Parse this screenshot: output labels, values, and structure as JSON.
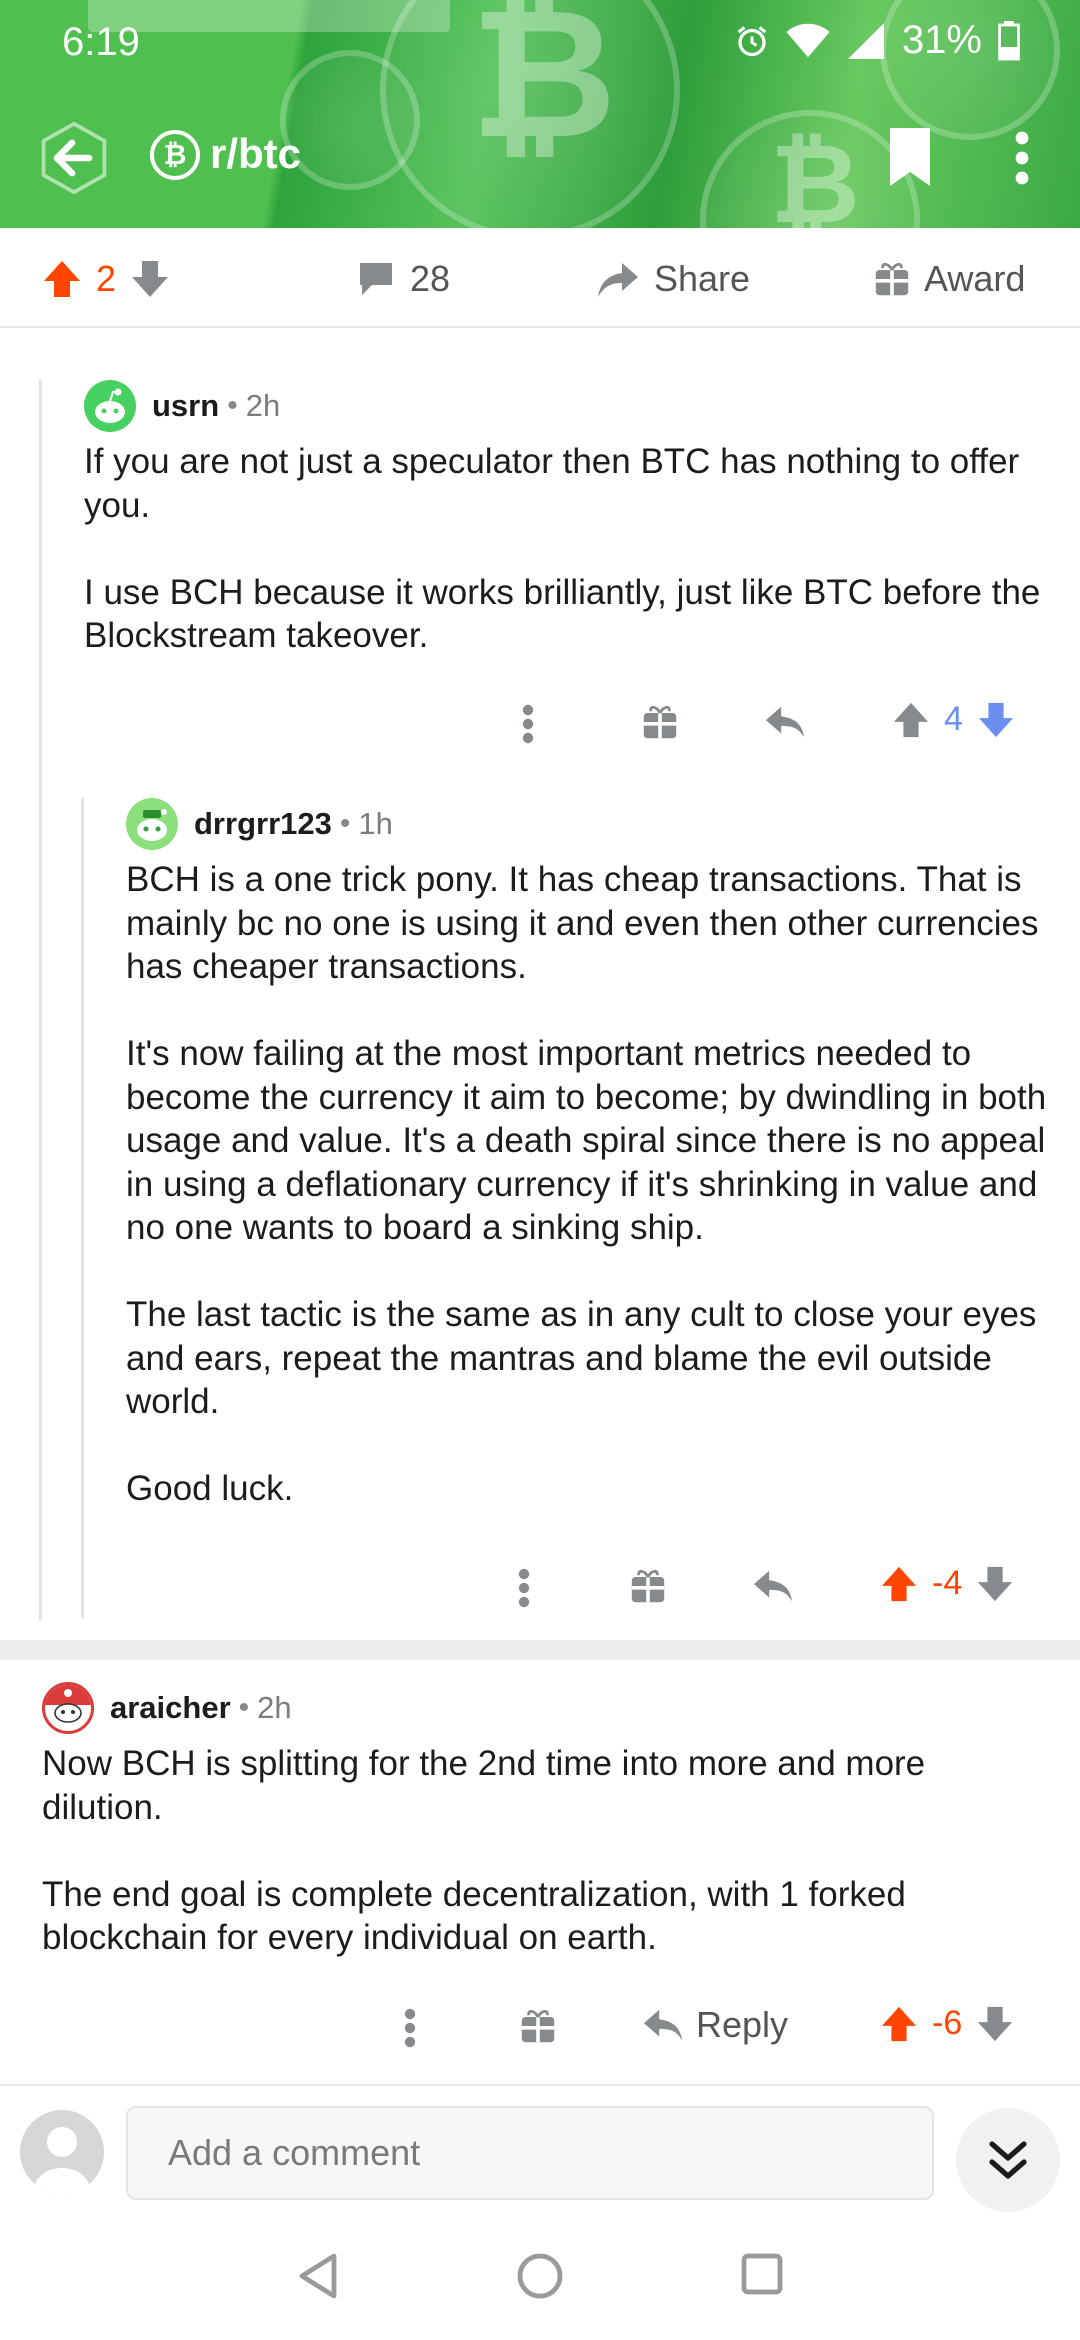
{
  "status": {
    "time": "6:19",
    "battery": "31%"
  },
  "subreddit": {
    "name": "r/btc",
    "icon_glyph": "₿"
  },
  "post_actions": {
    "score": "2",
    "comments": "28",
    "share": "Share",
    "award": "Award"
  },
  "comments": [
    {
      "user": "usrn",
      "time": "2h",
      "paragraphs": [
        "If you are not just a speculator then BTC has nothing to offer you.",
        "I use BCH because it works brilliantly, just like BTC before the Blockstream takeover."
      ],
      "score": "4",
      "vote_state": "downvoted"
    },
    {
      "user": "drrgrr123",
      "time": "1h",
      "paragraphs": [
        "BCH is a one trick pony. It has cheap transactions. That is mainly bc no one is using it and even then other currencies has cheaper transactions.",
        "It's now failing at the most important metrics needed to become the currency it aim to become; by dwindling in both usage and value. It's a death spiral since there is no appeal in using a deflationary currency if it's shrinking in value and no one wants to board a sinking ship.",
        "The last tactic is the same as in any cult to close your eyes and ears, repeat the mantras and blame the evil outside world.",
        "Good luck."
      ],
      "score": "-4",
      "vote_state": "upvoted"
    },
    {
      "user": "araicher",
      "time": "2h",
      "paragraphs": [
        "Now BCH is splitting for the 2nd time into more and more dilution.",
        "The end goal is complete decentralization, with 1 forked blockchain for every individual on earth."
      ],
      "score": "-6",
      "reply_label": "Reply",
      "vote_state": "upvoted"
    }
  ],
  "composer": {
    "placeholder": "Add a comment"
  },
  "colors": {
    "upvote": "#ff4500",
    "downvote": "#6a8ff0",
    "header_green": "#4fbf4f",
    "icon_gray": "#878a8c"
  }
}
